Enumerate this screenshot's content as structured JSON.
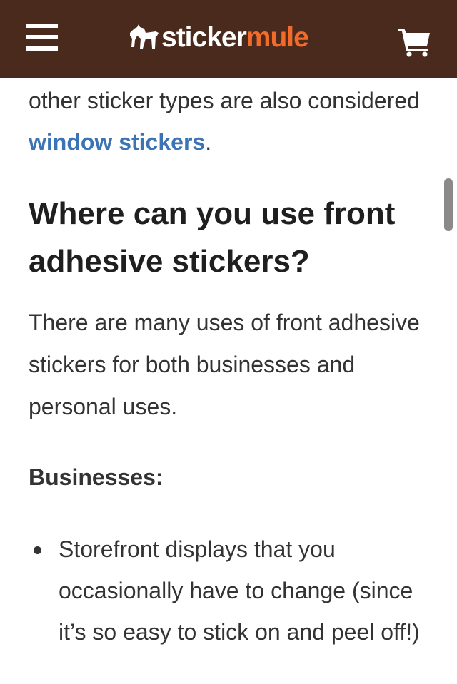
{
  "header": {
    "menu_icon": "hamburger-menu-icon",
    "logo": {
      "icon": "mule-icon",
      "text_part1": "sticker",
      "text_part2": "mule",
      "color_part1": "#ffffff",
      "color_part2": "#f26b2b"
    },
    "cart_icon": "shopping-cart-icon",
    "background": "#4a2a1c"
  },
  "article": {
    "intro_prefix": "other sticker types are also considered ",
    "intro_link": "window stickers",
    "intro_suffix": ".",
    "heading": "Where can you use front adhesive stickers?",
    "paragraph": "There are many uses of front adhesive stickers for both businesses and personal uses.",
    "subheading": "Businesses:",
    "list": [
      "Storefront displays that you occasionally have to change (since it’s so easy to stick on and peel off!)"
    ]
  },
  "colors": {
    "link": "#3b73b5",
    "text": "#333333"
  }
}
